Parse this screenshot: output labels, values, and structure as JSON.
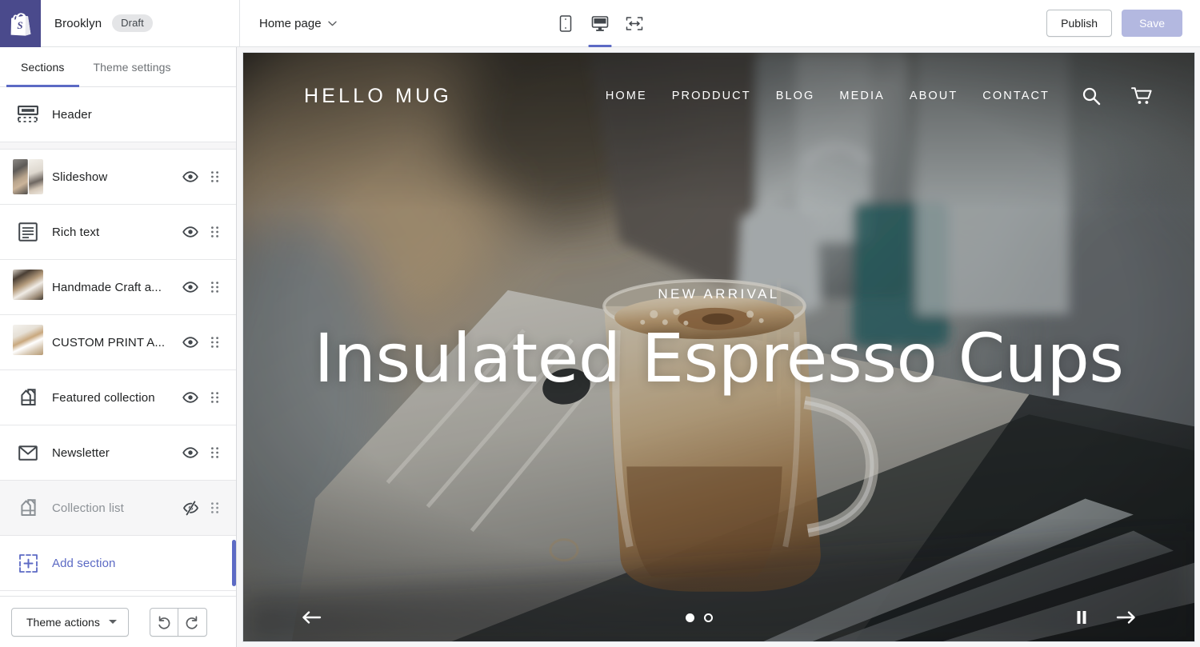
{
  "topbar": {
    "logo_icon": "shopify-bag-icon",
    "shop_name": "Brooklyn",
    "status_badge": "Draft",
    "page_selector": "Home page",
    "chevron_icon": "chevron-down-icon",
    "devices": [
      {
        "name": "mobile",
        "icon": "mobile-icon",
        "active": false
      },
      {
        "name": "desktop",
        "icon": "desktop-icon",
        "active": true
      },
      {
        "name": "full-width",
        "icon": "full-width-icon",
        "active": false
      }
    ],
    "publish_label": "Publish",
    "save_label": "Save",
    "accent": "#5c6ac4",
    "logo_bg": "#4a4a8c"
  },
  "sidebar": {
    "tabs": [
      {
        "label": "Sections",
        "active": true
      },
      {
        "label": "Theme settings",
        "active": false
      }
    ],
    "header_section": {
      "label": "Header",
      "icon": "header-layout-icon"
    },
    "sections": [
      {
        "label": "Slideshow",
        "icon": "image-thumbnail",
        "visible": true,
        "visibility_icon": "eye-icon",
        "drag_icon": "drag-handle-icon"
      },
      {
        "label": "Rich text",
        "icon": "rich-text-icon",
        "visible": true,
        "visibility_icon": "eye-icon",
        "drag_icon": "drag-handle-icon"
      },
      {
        "label": "Handmade Craft a...",
        "icon": "image-thumbnail",
        "visible": true,
        "visibility_icon": "eye-icon",
        "drag_icon": "drag-handle-icon"
      },
      {
        "label": "CUSTOM PRINT A...",
        "icon": "image-thumbnail",
        "visible": true,
        "visibility_icon": "eye-icon",
        "drag_icon": "drag-handle-icon"
      },
      {
        "label": "Featured collection",
        "icon": "collection-tag-icon",
        "visible": true,
        "visibility_icon": "eye-icon",
        "drag_icon": "drag-handle-icon"
      },
      {
        "label": "Newsletter",
        "icon": "envelope-icon",
        "visible": true,
        "visibility_icon": "eye-icon",
        "drag_icon": "drag-handle-icon"
      },
      {
        "label": "Collection list",
        "icon": "collection-tag-icon",
        "visible": false,
        "visibility_icon": "eye-off-icon",
        "drag_icon": "drag-handle-icon"
      }
    ],
    "add_section": {
      "label": "Add section",
      "icon": "add-section-icon"
    },
    "footer": {
      "theme_actions_label": "Theme actions",
      "caret_icon": "caret-down-icon",
      "undo_icon": "undo-icon",
      "redo_icon": "redo-icon"
    }
  },
  "preview": {
    "store_logo": "HELLO MUG",
    "menu": [
      {
        "label": "HOME"
      },
      {
        "label": "PRODDUCT"
      },
      {
        "label": "BLOG"
      },
      {
        "label": "MEDIA"
      },
      {
        "label": "ABOUT"
      },
      {
        "label": "CONTACT"
      }
    ],
    "search_icon": "search-icon",
    "cart_icon": "cart-icon",
    "hero": {
      "kicker": "NEW ARRIVAL",
      "title": "Insulated Espresso Cups"
    },
    "slideshow": {
      "prev_icon": "arrow-left-icon",
      "next_icon": "arrow-right-icon",
      "pause_icon": "pause-icon",
      "dots": [
        {
          "active": true
        },
        {
          "active": false
        }
      ]
    }
  }
}
